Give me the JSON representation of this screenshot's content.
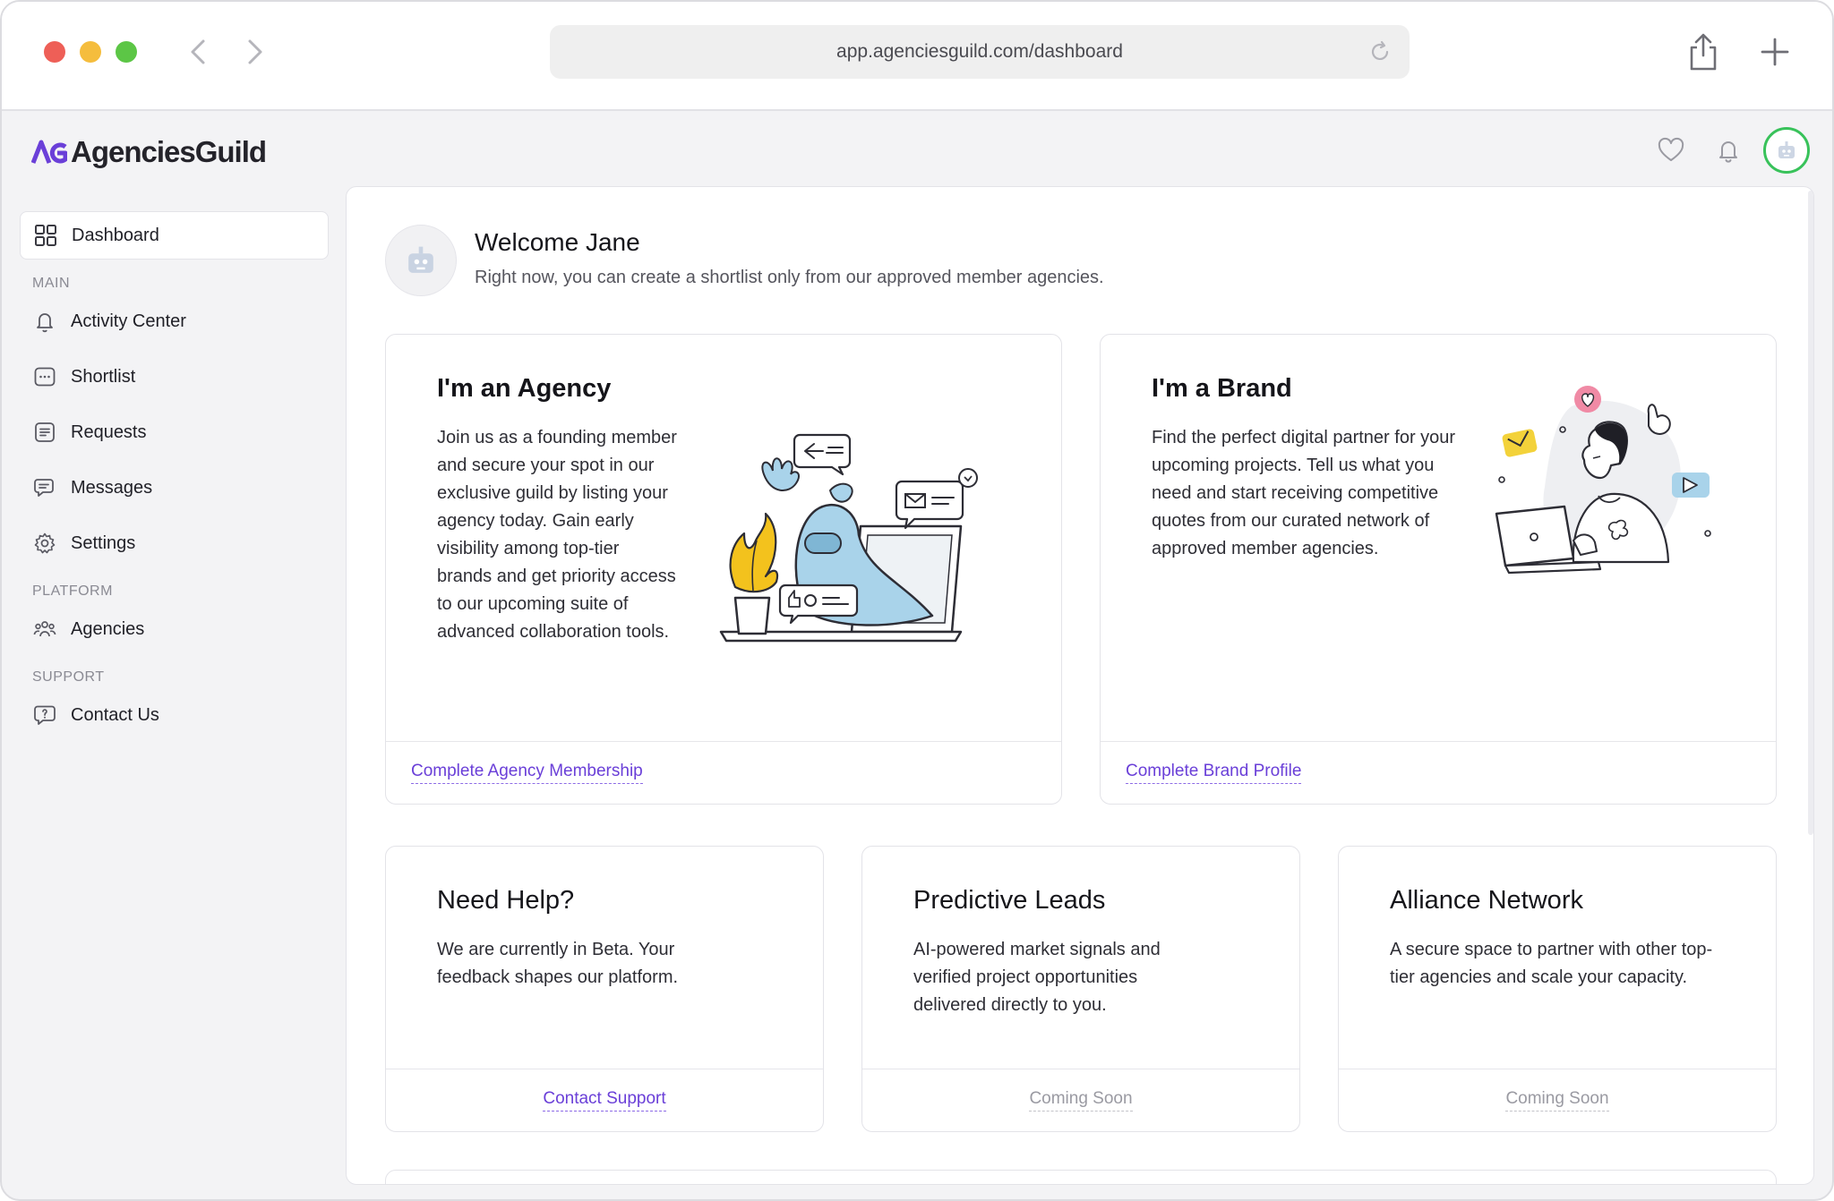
{
  "browser": {
    "url": "app.agenciesguild.com/dashboard"
  },
  "app": {
    "logo_text": "AgenciesGuild"
  },
  "sidebar": {
    "dashboard": "Dashboard",
    "section_main": "MAIN",
    "activity_center": "Activity Center",
    "shortlist": "Shortlist",
    "requests": "Requests",
    "messages": "Messages",
    "settings": "Settings",
    "section_platform": "PLATFORM",
    "agencies": "Agencies",
    "section_support": "SUPPORT",
    "contact_us": "Contact Us"
  },
  "welcome": {
    "title": "Welcome Jane",
    "subtitle": "Right now, you can create a shortlist only from our approved member agencies."
  },
  "cards": {
    "agency": {
      "title": "I'm an Agency",
      "body": "Join us as a founding member and secure your spot in our exclusive guild by listing your agency today. Gain early visibility among top-tier brands and get priority access to our upcoming suite of advanced collaboration tools.",
      "link": "Complete Agency Membership"
    },
    "brand": {
      "title": "I'm a Brand",
      "body": "Find the perfect digital partner for your upcoming projects. Tell us what you need and start receiving competitive quotes from our curated network of approved member agencies.",
      "link": "Complete Brand Profile"
    },
    "help": {
      "title": "Need Help?",
      "body": "We are currently in Beta. Your feedback shapes our platform.",
      "link": "Contact Support"
    },
    "leads": {
      "title": "Predictive Leads",
      "body": "AI-powered market signals and verified project opportunities delivered directly to you.",
      "link": "Coming Soon"
    },
    "alliance": {
      "title": "Alliance Network",
      "body": "A secure space to partner with other top-tier agencies and scale your capacity.",
      "link": "Coming Soon"
    }
  },
  "colors": {
    "accent": "#6a3fd8",
    "online_ring": "#38c25a",
    "illustration_blue": "#a9d3ea",
    "illustration_yellow": "#f3c21d",
    "illustration_pink": "#f08aa5"
  }
}
